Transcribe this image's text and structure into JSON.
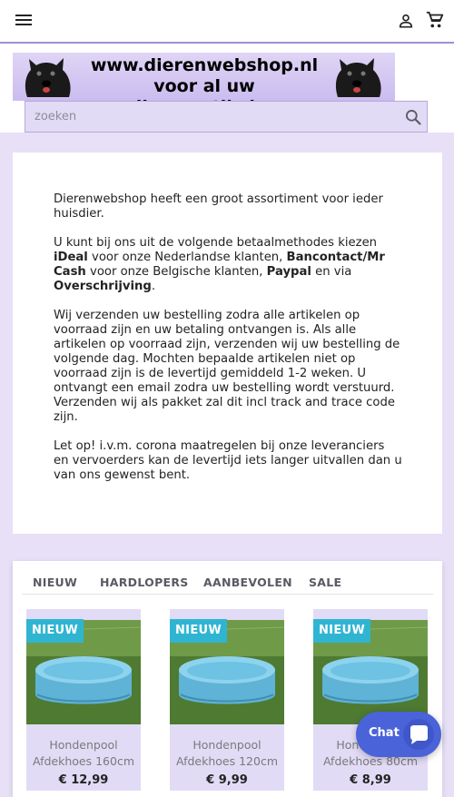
{
  "header": {
    "menu_icon": "hamburger-menu-icon",
    "user_icon": "user-account-icon",
    "cart_icon": "shopping-cart-icon",
    "accent_color": "#a38fd6"
  },
  "logo": {
    "line1": "www.dierenwebshop.nl",
    "line2": "voor al uw dierenartikelen"
  },
  "search": {
    "placeholder": "zoeken",
    "value": "",
    "button_icon": "search-icon"
  },
  "info": {
    "p1": "Dierenwebshop heeft een groot assortiment voor ieder huisdier.",
    "p2_a": "U kunt bij ons uit de volgende betaalmethodes kiezen ",
    "p2_ideal": "iDeal",
    "p2_b": " voor onze Nederlandse klanten, ",
    "p2_bancontact": "Bancontact/Mr Cash",
    "p2_c": " voor onze Belgische klanten, ",
    "p2_paypal": "Paypal",
    "p2_d": " en via ",
    "p2_overschrijving": "Overschrijving",
    "p2_e": ".",
    "p3": "Wij verzenden uw bestelling zodra alle artikelen op voorraad zijn en uw betaling ontvangen is. Als alle artikelen op voorraad zijn, verzenden wij uw bestelling de volgende dag. Mochten bepaalde artikelen niet op voorraad zijn is de levertijd gemiddeld 1-2 weken. U ontvangt een email zodra uw bestelling wordt verstuurd. Verzenden wij als pakket zal dit incl track and trace code zijn.",
    "p4": "Let op! i.v.m. corona maatregelen bij onze leveranciers en vervoerders kan de levertijd iets langer uitvallen dan u van ons gewenst bent."
  },
  "tabs": [
    "NIEUW",
    "HARDLOPERS",
    "AANBEVOLEN",
    "SALE"
  ],
  "products": [
    {
      "badge": "NIEUW",
      "name": "Hondenpool Afdekhoes 160cm",
      "price": "€ 12,99"
    },
    {
      "badge": "NIEUW",
      "name": "Hondenpool Afdekhoes 120cm",
      "price": "€ 9,99"
    },
    {
      "badge": "NIEUW",
      "name": "Hondenpool Afdekhoes 80cm",
      "price": "€ 8,99"
    }
  ],
  "chat": {
    "label": "Chat",
    "icon": "chat-bubble-icon",
    "color": "#4a63d9"
  },
  "colors": {
    "page_bg": "#e7e0f7",
    "badge": "#2fb5d2",
    "product_bg": "#e2dbf6"
  }
}
